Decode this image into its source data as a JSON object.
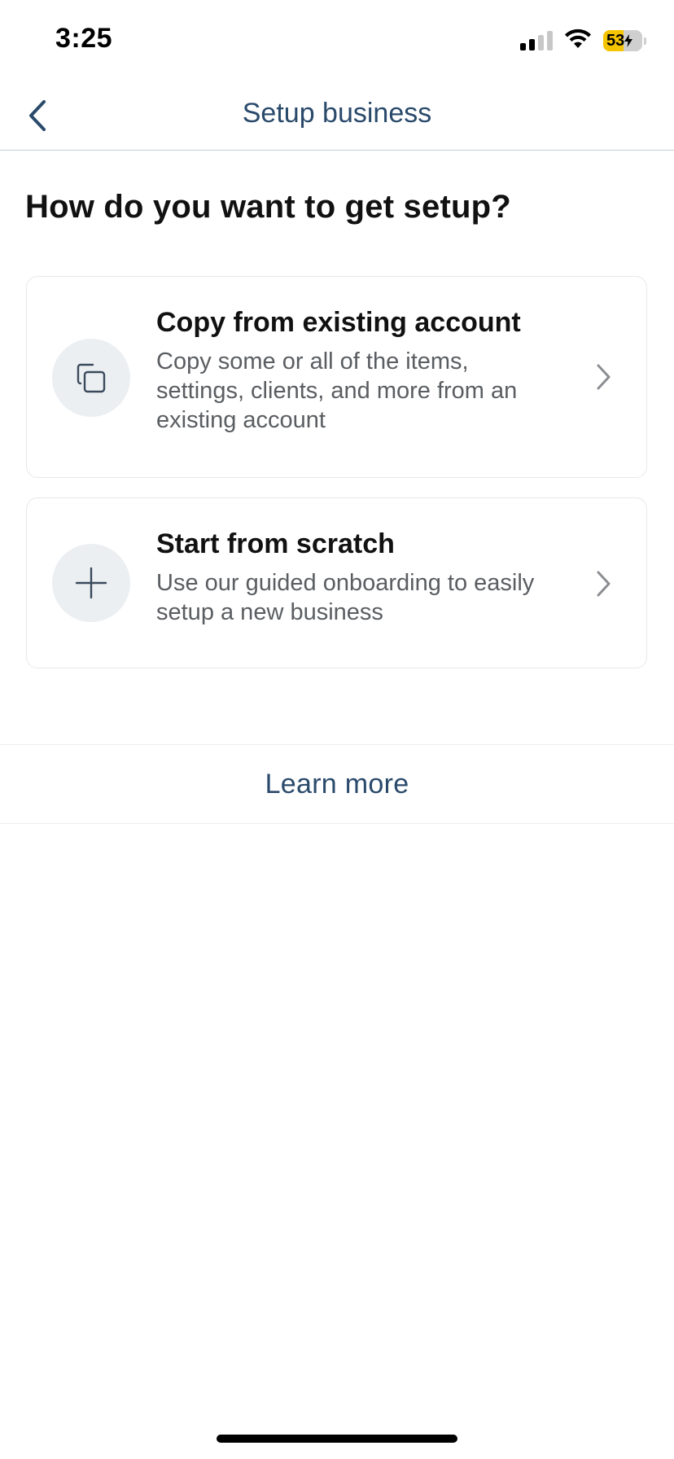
{
  "status_bar": {
    "time": "3:25",
    "battery_percent": "53",
    "battery_level": 0.53,
    "battery_fill_color": "#f5c400",
    "signal_bars_active": 2,
    "signal_bars_total": 4
  },
  "nav": {
    "back_icon": "chevron-left-icon",
    "title": "Setup business",
    "accent_color": "#2a4a6b"
  },
  "main": {
    "heading": "How do you want to get setup?",
    "options": [
      {
        "icon": "copy-icon",
        "title": "Copy from existing account",
        "description": "Copy some or all of the items, settings, clients, and more from an existing account",
        "chevron": "chevron-right-icon"
      },
      {
        "icon": "plus-icon",
        "title": "Start from scratch",
        "description": "Use our guided onboarding to easily setup a new business",
        "chevron": "chevron-right-icon"
      }
    ]
  },
  "footer": {
    "learn_more_label": "Learn more"
  }
}
